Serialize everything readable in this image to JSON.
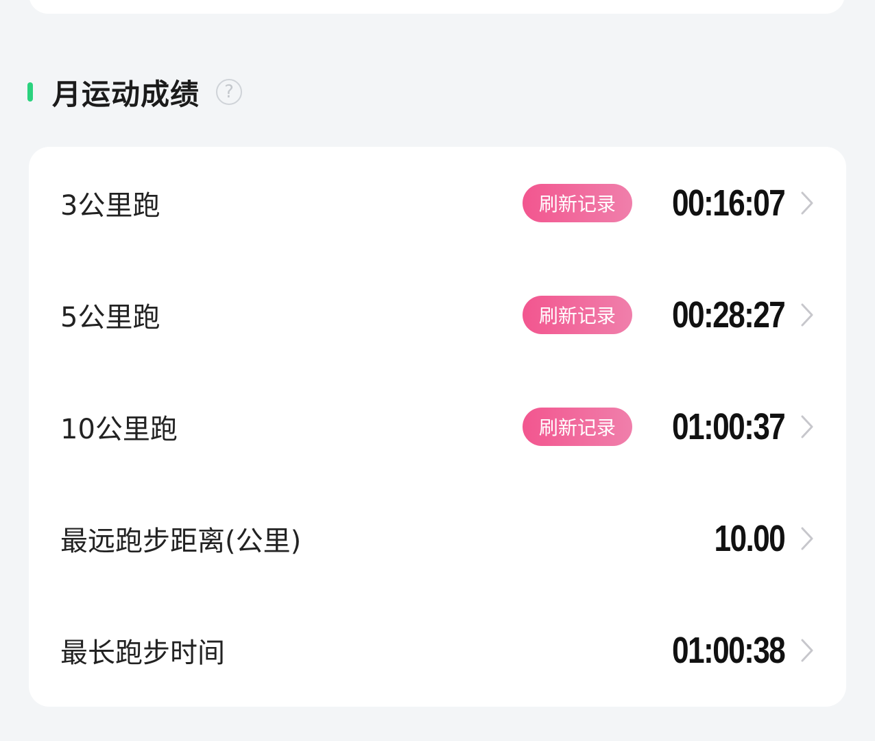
{
  "section": {
    "title": "月运动成绩",
    "help_icon": "question-circle-icon",
    "accent_color": "#2bd27e"
  },
  "records": [
    {
      "label": "3公里跑",
      "badge": "刷新记录",
      "value": "00:16:07"
    },
    {
      "label": "5公里跑",
      "badge": "刷新记录",
      "value": "00:28:27"
    },
    {
      "label": "10公里跑",
      "badge": "刷新记录",
      "value": "01:00:37"
    },
    {
      "label": "最远跑步距离(公里)",
      "badge": null,
      "value": "10.00"
    },
    {
      "label": "最长跑步时间",
      "badge": null,
      "value": "01:00:38"
    }
  ],
  "colors": {
    "background": "#f3f5f7",
    "card": "#ffffff",
    "badge_start": "#f2568f",
    "badge_end": "#f07fab",
    "chevron": "#c7c7cc"
  }
}
